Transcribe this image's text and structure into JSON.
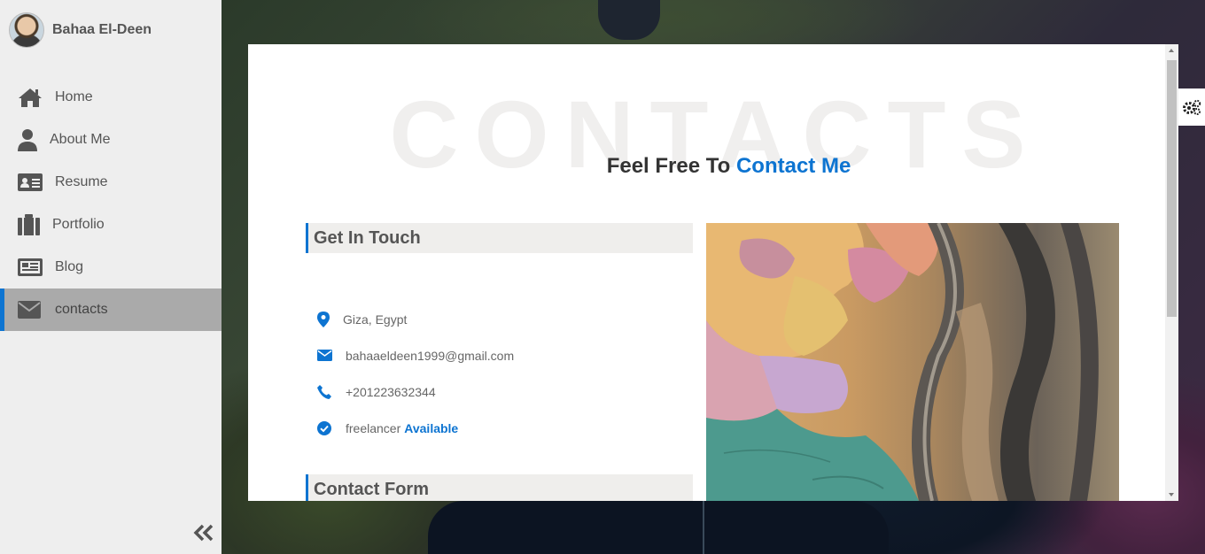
{
  "profile": {
    "name": "Bahaa El-Deen"
  },
  "nav": [
    {
      "label": "Home",
      "icon": "home-icon"
    },
    {
      "label": "About Me",
      "icon": "user-icon"
    },
    {
      "label": "Resume",
      "icon": "id-card-icon"
    },
    {
      "label": "Portfolio",
      "icon": "briefcase-icon"
    },
    {
      "label": "Blog",
      "icon": "newspaper-icon"
    },
    {
      "label": "contacts",
      "icon": "envelope-icon",
      "active": true
    }
  ],
  "collapse_icon": "double-chevron-left-icon",
  "contacts": {
    "watermark": "CONTACTS",
    "headline_prefix": "Feel Free To",
    "headline_accent": "Contact Me",
    "get_in_touch_title": "Get In Touch",
    "contact_form_title": "Contact Form",
    "location": "Giza, Egypt",
    "email": "bahaaeldeen1999@gmail.com",
    "phone": "+201223632344",
    "freelancer_label": "freelancer",
    "freelancer_status": "Available"
  },
  "settings_icon": "gears-icon",
  "colors": {
    "accent": "#0d74d1",
    "sidebar": "#eeeeee",
    "active_item": "#aaaaaa"
  }
}
